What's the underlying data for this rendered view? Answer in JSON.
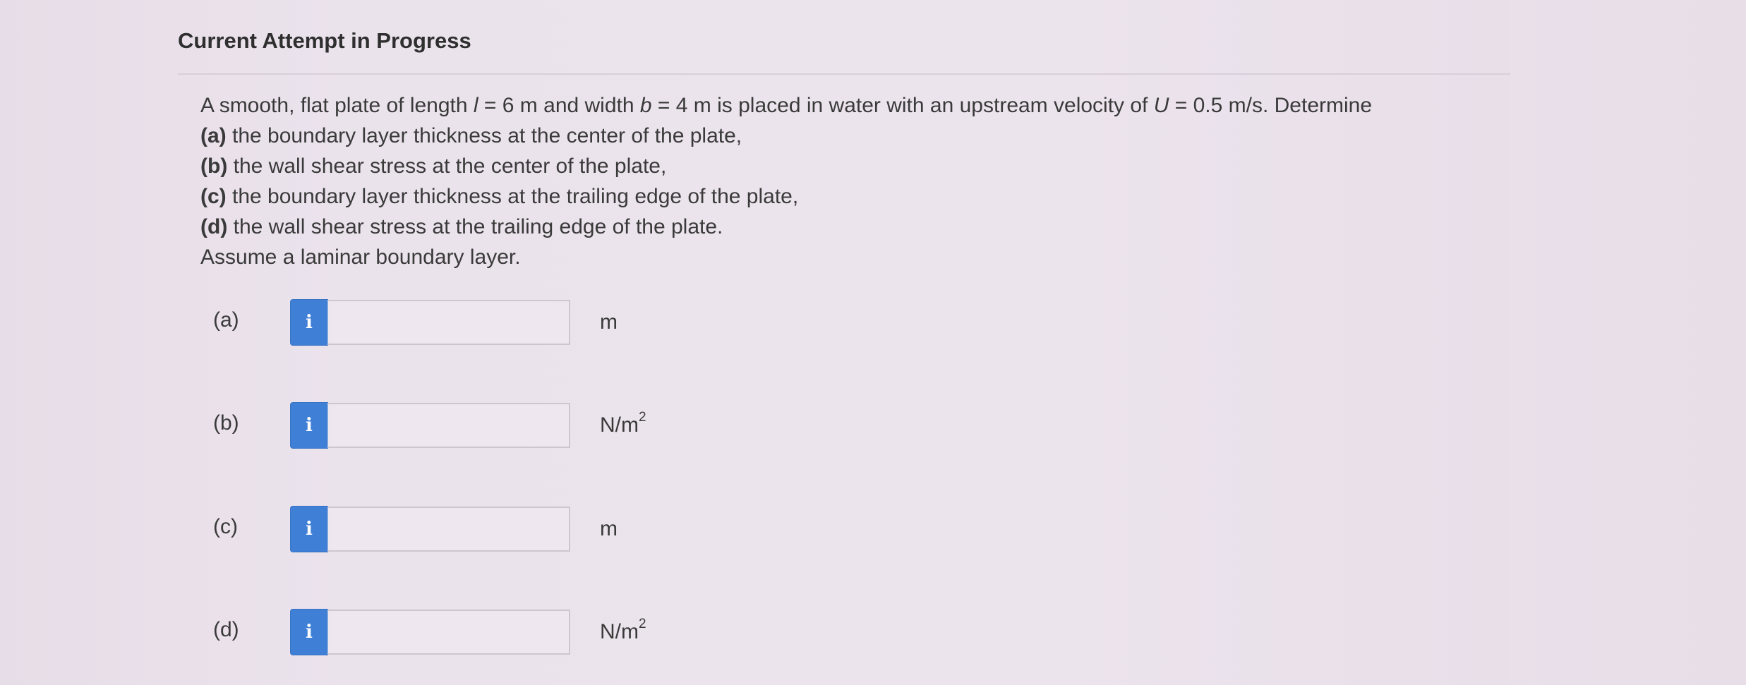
{
  "header": {
    "title": "Current Attempt in Progress"
  },
  "problem": {
    "intro_1": "A smooth, flat plate of length ",
    "var_l": "l",
    "intro_2": " = 6 m and width ",
    "var_b": "b",
    "intro_3": " = 4 m is placed in water with an upstream velocity of ",
    "var_U": "U",
    "intro_4": " = 0.5 m/s. Determine",
    "items": [
      {
        "tag": "(a)",
        "text": " the boundary layer thickness at the center of the plate,"
      },
      {
        "tag": "(b)",
        "text": " the wall shear stress at the center of the plate,"
      },
      {
        "tag": "(c)",
        "text": " the boundary layer thickness at the trailing edge of the plate,"
      },
      {
        "tag": "(d)",
        "text": " the wall shear stress at the trailing edge of the plate."
      }
    ],
    "assumption": "Assume a laminar boundary layer."
  },
  "answers": [
    {
      "label": "(a)",
      "info_icon": "i",
      "value": "",
      "unit_base": "m",
      "unit_sup": ""
    },
    {
      "label": "(b)",
      "info_icon": "i",
      "value": "",
      "unit_base": "N/m",
      "unit_sup": "2"
    },
    {
      "label": "(c)",
      "info_icon": "i",
      "value": "",
      "unit_base": "m",
      "unit_sup": ""
    },
    {
      "label": "(d)",
      "info_icon": "i",
      "value": "",
      "unit_base": "N/m",
      "unit_sup": "2"
    }
  ],
  "colors": {
    "info_button": "#3f7fd6",
    "background": "#e9e0ea",
    "text": "#3a3a3a"
  }
}
